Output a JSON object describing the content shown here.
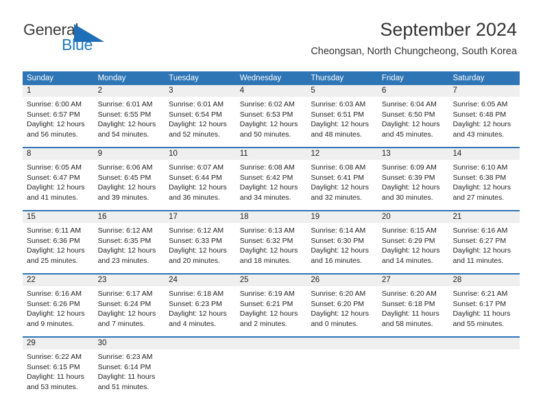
{
  "brand": {
    "name_top": "General",
    "name_bottom": "Blue",
    "triangle_icon": "blue-triangle-icon",
    "color_top": "#3c3c3c",
    "color_bottom": "#1f7ac4"
  },
  "header": {
    "title": "September 2024",
    "subtitle": "Cheongsan, North Chungcheong, South Korea"
  },
  "theme": {
    "header_blue": "#2E75B6",
    "day_band_gray": "#efefef",
    "text": "#222222"
  },
  "weekdays": [
    "Sunday",
    "Monday",
    "Tuesday",
    "Wednesday",
    "Thursday",
    "Friday",
    "Saturday"
  ],
  "weeks": [
    [
      {
        "day": "1",
        "lines": [
          "Sunrise: 6:00 AM",
          "Sunset: 6:57 PM",
          "Daylight: 12 hours",
          "and 56 minutes."
        ]
      },
      {
        "day": "2",
        "lines": [
          "Sunrise: 6:01 AM",
          "Sunset: 6:55 PM",
          "Daylight: 12 hours",
          "and 54 minutes."
        ]
      },
      {
        "day": "3",
        "lines": [
          "Sunrise: 6:01 AM",
          "Sunset: 6:54 PM",
          "Daylight: 12 hours",
          "and 52 minutes."
        ]
      },
      {
        "day": "4",
        "lines": [
          "Sunrise: 6:02 AM",
          "Sunset: 6:53 PM",
          "Daylight: 12 hours",
          "and 50 minutes."
        ]
      },
      {
        "day": "5",
        "lines": [
          "Sunrise: 6:03 AM",
          "Sunset: 6:51 PM",
          "Daylight: 12 hours",
          "and 48 minutes."
        ]
      },
      {
        "day": "6",
        "lines": [
          "Sunrise: 6:04 AM",
          "Sunset: 6:50 PM",
          "Daylight: 12 hours",
          "and 45 minutes."
        ]
      },
      {
        "day": "7",
        "lines": [
          "Sunrise: 6:05 AM",
          "Sunset: 6:48 PM",
          "Daylight: 12 hours",
          "and 43 minutes."
        ]
      }
    ],
    [
      {
        "day": "8",
        "lines": [
          "Sunrise: 6:05 AM",
          "Sunset: 6:47 PM",
          "Daylight: 12 hours",
          "and 41 minutes."
        ]
      },
      {
        "day": "9",
        "lines": [
          "Sunrise: 6:06 AM",
          "Sunset: 6:45 PM",
          "Daylight: 12 hours",
          "and 39 minutes."
        ]
      },
      {
        "day": "10",
        "lines": [
          "Sunrise: 6:07 AM",
          "Sunset: 6:44 PM",
          "Daylight: 12 hours",
          "and 36 minutes."
        ]
      },
      {
        "day": "11",
        "lines": [
          "Sunrise: 6:08 AM",
          "Sunset: 6:42 PM",
          "Daylight: 12 hours",
          "and 34 minutes."
        ]
      },
      {
        "day": "12",
        "lines": [
          "Sunrise: 6:08 AM",
          "Sunset: 6:41 PM",
          "Daylight: 12 hours",
          "and 32 minutes."
        ]
      },
      {
        "day": "13",
        "lines": [
          "Sunrise: 6:09 AM",
          "Sunset: 6:39 PM",
          "Daylight: 12 hours",
          "and 30 minutes."
        ]
      },
      {
        "day": "14",
        "lines": [
          "Sunrise: 6:10 AM",
          "Sunset: 6:38 PM",
          "Daylight: 12 hours",
          "and 27 minutes."
        ]
      }
    ],
    [
      {
        "day": "15",
        "lines": [
          "Sunrise: 6:11 AM",
          "Sunset: 6:36 PM",
          "Daylight: 12 hours",
          "and 25 minutes."
        ]
      },
      {
        "day": "16",
        "lines": [
          "Sunrise: 6:12 AM",
          "Sunset: 6:35 PM",
          "Daylight: 12 hours",
          "and 23 minutes."
        ]
      },
      {
        "day": "17",
        "lines": [
          "Sunrise: 6:12 AM",
          "Sunset: 6:33 PM",
          "Daylight: 12 hours",
          "and 20 minutes."
        ]
      },
      {
        "day": "18",
        "lines": [
          "Sunrise: 6:13 AM",
          "Sunset: 6:32 PM",
          "Daylight: 12 hours",
          "and 18 minutes."
        ]
      },
      {
        "day": "19",
        "lines": [
          "Sunrise: 6:14 AM",
          "Sunset: 6:30 PM",
          "Daylight: 12 hours",
          "and 16 minutes."
        ]
      },
      {
        "day": "20",
        "lines": [
          "Sunrise: 6:15 AM",
          "Sunset: 6:29 PM",
          "Daylight: 12 hours",
          "and 14 minutes."
        ]
      },
      {
        "day": "21",
        "lines": [
          "Sunrise: 6:16 AM",
          "Sunset: 6:27 PM",
          "Daylight: 12 hours",
          "and 11 minutes."
        ]
      }
    ],
    [
      {
        "day": "22",
        "lines": [
          "Sunrise: 6:16 AM",
          "Sunset: 6:26 PM",
          "Daylight: 12 hours",
          "and 9 minutes."
        ]
      },
      {
        "day": "23",
        "lines": [
          "Sunrise: 6:17 AM",
          "Sunset: 6:24 PM",
          "Daylight: 12 hours",
          "and 7 minutes."
        ]
      },
      {
        "day": "24",
        "lines": [
          "Sunrise: 6:18 AM",
          "Sunset: 6:23 PM",
          "Daylight: 12 hours",
          "and 4 minutes."
        ]
      },
      {
        "day": "25",
        "lines": [
          "Sunrise: 6:19 AM",
          "Sunset: 6:21 PM",
          "Daylight: 12 hours",
          "and 2 minutes."
        ]
      },
      {
        "day": "26",
        "lines": [
          "Sunrise: 6:20 AM",
          "Sunset: 6:20 PM",
          "Daylight: 12 hours",
          "and 0 minutes."
        ]
      },
      {
        "day": "27",
        "lines": [
          "Sunrise: 6:20 AM",
          "Sunset: 6:18 PM",
          "Daylight: 11 hours",
          "and 58 minutes."
        ]
      },
      {
        "day": "28",
        "lines": [
          "Sunrise: 6:21 AM",
          "Sunset: 6:17 PM",
          "Daylight: 11 hours",
          "and 55 minutes."
        ]
      }
    ],
    [
      {
        "day": "29",
        "lines": [
          "Sunrise: 6:22 AM",
          "Sunset: 6:15 PM",
          "Daylight: 11 hours",
          "and 53 minutes."
        ]
      },
      {
        "day": "30",
        "lines": [
          "Sunrise: 6:23 AM",
          "Sunset: 6:14 PM",
          "Daylight: 11 hours",
          "and 51 minutes."
        ]
      },
      {
        "day": "",
        "lines": []
      },
      {
        "day": "",
        "lines": []
      },
      {
        "day": "",
        "lines": []
      },
      {
        "day": "",
        "lines": []
      },
      {
        "day": "",
        "lines": []
      }
    ]
  ]
}
